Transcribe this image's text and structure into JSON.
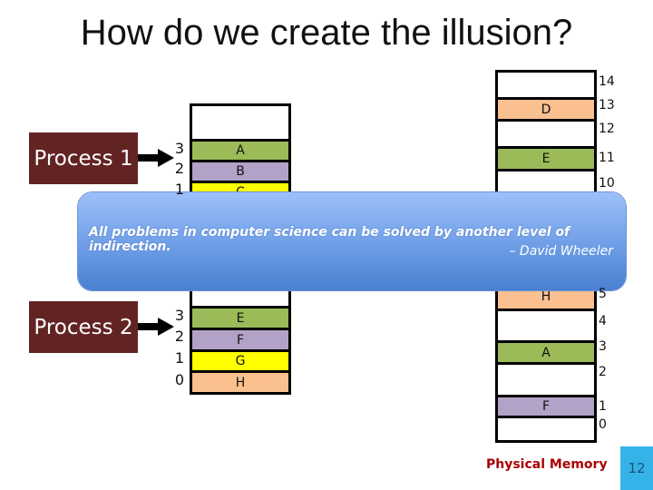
{
  "title": "How do we create the illusion?",
  "process1": {
    "label": "Process 1",
    "indices": [
      "3",
      "2",
      "1"
    ],
    "pages": [
      {
        "label": "A",
        "color": "#9bbb59"
      },
      {
        "label": "B",
        "color": "#b2a2c7"
      },
      {
        "label": "C",
        "color": "#ffff00"
      }
    ]
  },
  "process2": {
    "label": "Process 2",
    "indices": [
      "3",
      "2",
      "1",
      "0"
    ],
    "pages": [
      {
        "label": "E",
        "color": "#9bbb59"
      },
      {
        "label": "F",
        "color": "#b2a2c7"
      },
      {
        "label": "G",
        "color": "#ffff00"
      },
      {
        "label": "H",
        "color": "#fac090"
      }
    ]
  },
  "physical": {
    "label": "Physical Memory",
    "frames": [
      {
        "num": "14",
        "label": "",
        "color": "#ffffff"
      },
      {
        "num": "13",
        "label": "D",
        "color": "#fac090"
      },
      {
        "num": "12",
        "label": "",
        "color": "#ffffff"
      },
      {
        "num": "11",
        "label": "E",
        "color": "#9bbb59"
      },
      {
        "num": "10",
        "label": "",
        "color": "#ffffff"
      },
      {
        "num": "5",
        "label": "H",
        "color": "#fac090"
      },
      {
        "num": "4",
        "label": "",
        "color": "#ffffff"
      },
      {
        "num": "3",
        "label": "A",
        "color": "#9bbb59"
      },
      {
        "num": "2",
        "label": "",
        "color": "#ffffff"
      },
      {
        "num": "1",
        "label": "F",
        "color": "#b2a2c7"
      },
      {
        "num": "0",
        "label": "",
        "color": "#ffffff"
      }
    ]
  },
  "quote": {
    "text": "All problems in computer science can be solved by another level of indirection.",
    "author": "– David Wheeler"
  },
  "slide_number": "12"
}
